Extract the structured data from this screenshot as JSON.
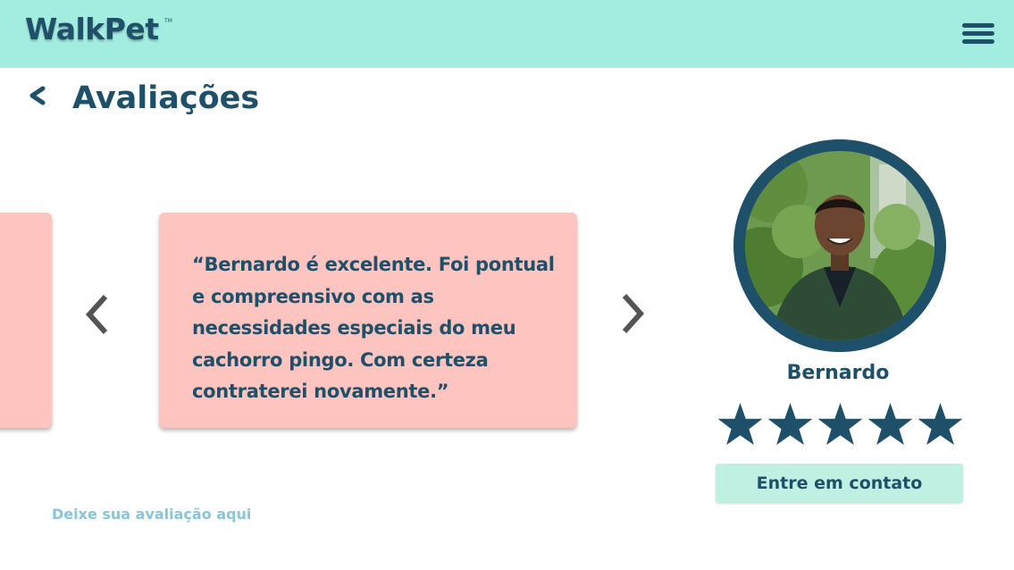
{
  "header": {
    "logo_text": "WalkPet",
    "logo_tm": "TM",
    "menu_icon": "hamburger-menu-icon"
  },
  "page": {
    "title": "Avaliações",
    "back_icon": "chevron-left-icon"
  },
  "carousel": {
    "prev_icon": "chevron-left-icon",
    "next_icon": "chevron-right-icon",
    "current_review": "“Bernardo é excelente. Foi pontual e compreensivo com as necessidades especiais do meu cachorro pingo. Com certeza contraterei novamente.”"
  },
  "walker": {
    "name": "Bernardo",
    "rating": 5,
    "rating_max": 5,
    "contact_label": "Entre em contato"
  },
  "footer": {
    "leave_review_label": "Deixe sua avaliação aqui"
  },
  "colors": {
    "header_bg": "#a2ede0",
    "primary_text": "#1f5069",
    "card_bg": "#fdc4c0",
    "contact_bg": "#bff0e2",
    "link_text": "#88c5d9",
    "arrow": "#555555"
  }
}
